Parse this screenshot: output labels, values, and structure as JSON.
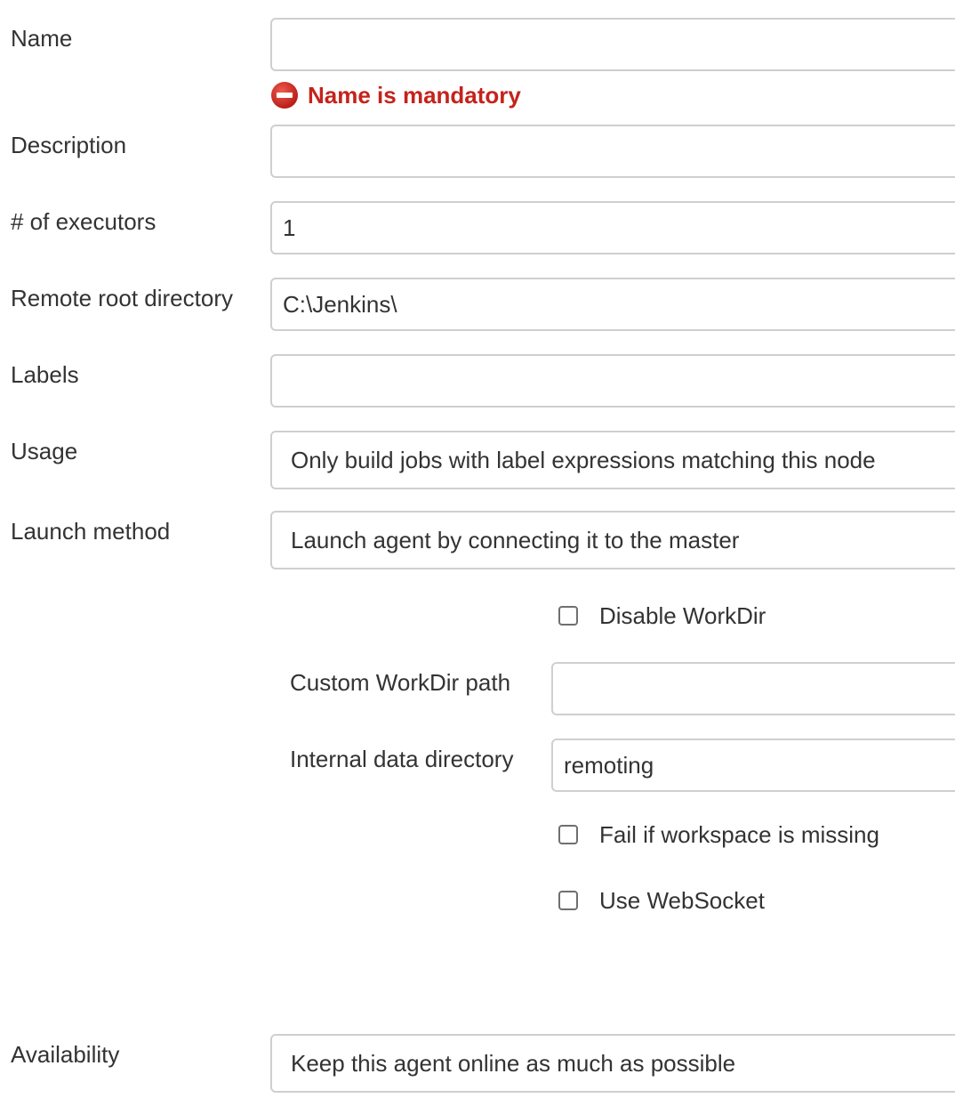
{
  "form": {
    "name": {
      "label": "Name",
      "value": "",
      "error": "Name is mandatory"
    },
    "description": {
      "label": "Description",
      "value": ""
    },
    "executors": {
      "label": "# of executors",
      "value": "1"
    },
    "remote_root": {
      "label": "Remote root directory",
      "value": "C:\\Jenkins\\"
    },
    "labels": {
      "label": "Labels",
      "value": ""
    },
    "usage": {
      "label": "Usage",
      "selected": "Only build jobs with label expressions matching this node"
    },
    "launch_method": {
      "label": "Launch method",
      "selected": "Launch agent by connecting it to the master",
      "disable_workdir": {
        "label": "Disable WorkDir",
        "checked": false
      },
      "custom_workdir": {
        "label": "Custom WorkDir path",
        "value": ""
      },
      "internal_data_dir": {
        "label": "Internal data directory",
        "value": "remoting"
      },
      "fail_if_missing": {
        "label": "Fail if workspace is missing",
        "checked": false
      },
      "use_websocket": {
        "label": "Use WebSocket",
        "checked": false
      }
    },
    "availability": {
      "label": "Availability",
      "selected": "Keep this agent online as much as possible"
    }
  },
  "colors": {
    "error": "#c4231c",
    "border": "#cfcfcf",
    "text": "#333333"
  },
  "icons": {
    "error": "error-minus-circle-icon"
  }
}
